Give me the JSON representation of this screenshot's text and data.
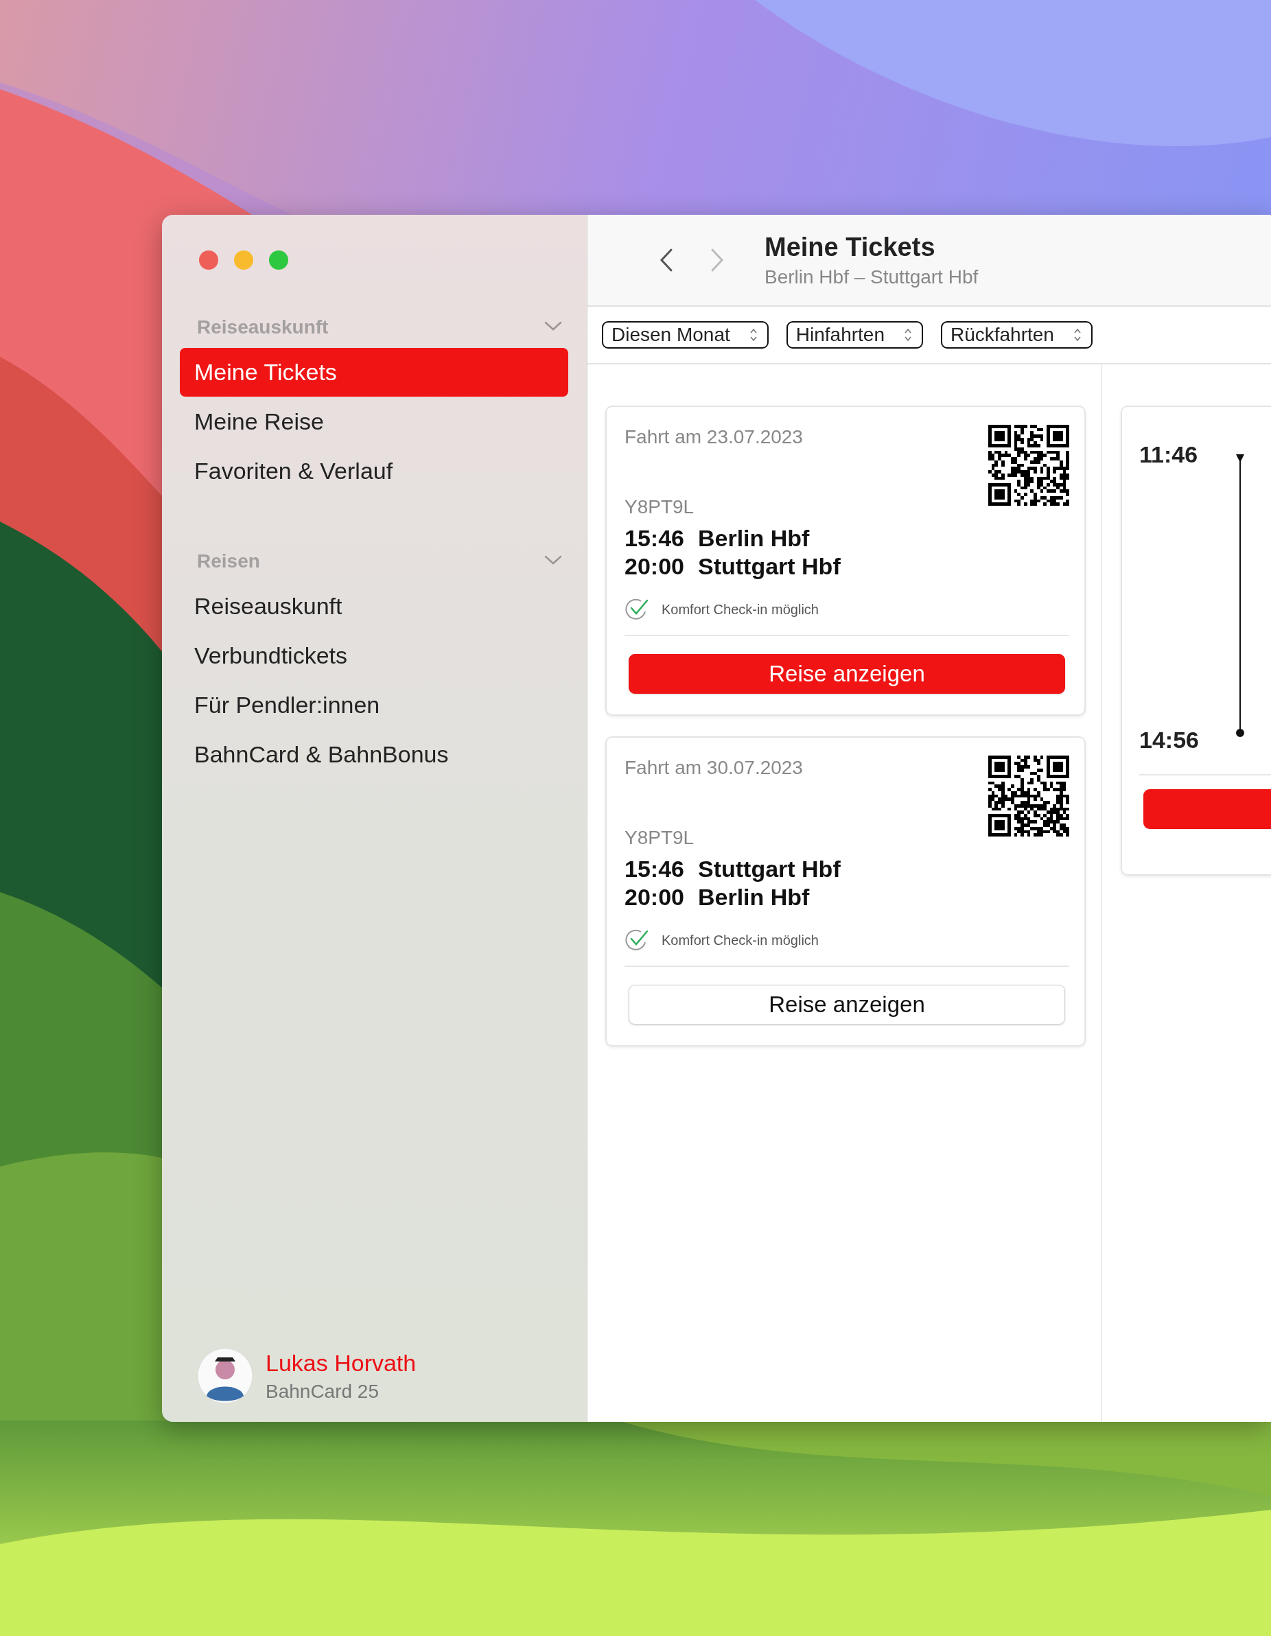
{
  "sidebar": {
    "sections": [
      {
        "title": "Reiseauskunft",
        "expanded": true,
        "items": [
          {
            "label": "Meine Tickets",
            "selected": true
          },
          {
            "label": "Meine Reise",
            "selected": false
          },
          {
            "label": "Favoriten & Verlauf",
            "selected": false
          }
        ]
      },
      {
        "title": "Reisen",
        "expanded": true,
        "items": [
          {
            "label": "Reiseauskunft",
            "selected": false
          },
          {
            "label": "Verbundtickets",
            "selected": false
          },
          {
            "label": "Für Pendler:innen",
            "selected": false
          },
          {
            "label": "BahnCard & BahnBonus",
            "selected": false
          }
        ]
      }
    ],
    "user": {
      "name": "Lukas Horvath",
      "subtitle": "BahnCard 25"
    }
  },
  "toolbar": {
    "title": "Meine Tickets",
    "subtitle": "Berlin Hbf – Stuttgart Hbf",
    "back_disabled": false,
    "forward_disabled": true
  },
  "filters": [
    {
      "label": "Diesen Monat"
    },
    {
      "label": "Hinfahrten"
    },
    {
      "label": "Rückfahrten"
    }
  ],
  "tickets": [
    {
      "date": "Fahrt am 23.07.2023",
      "code": "Y8PT9L",
      "stops": [
        {
          "time": "15:46",
          "station": "Berlin Hbf"
        },
        {
          "time": "20:00",
          "station": "Stuttgart Hbf"
        }
      ],
      "checkin": "Komfort Check-in möglich",
      "button": "Reise anzeigen",
      "primary": true
    },
    {
      "date": "Fahrt am 30.07.2023",
      "code": "Y8PT9L",
      "stops": [
        {
          "time": "15:46",
          "station": "Stuttgart Hbf"
        },
        {
          "time": "20:00",
          "station": "Berlin Hbf"
        }
      ],
      "checkin": "Komfort Check-in möglich",
      "button": "Reise anzeigen",
      "primary": false
    }
  ],
  "detail": {
    "departure": "11:46",
    "arrival": "14:56"
  }
}
